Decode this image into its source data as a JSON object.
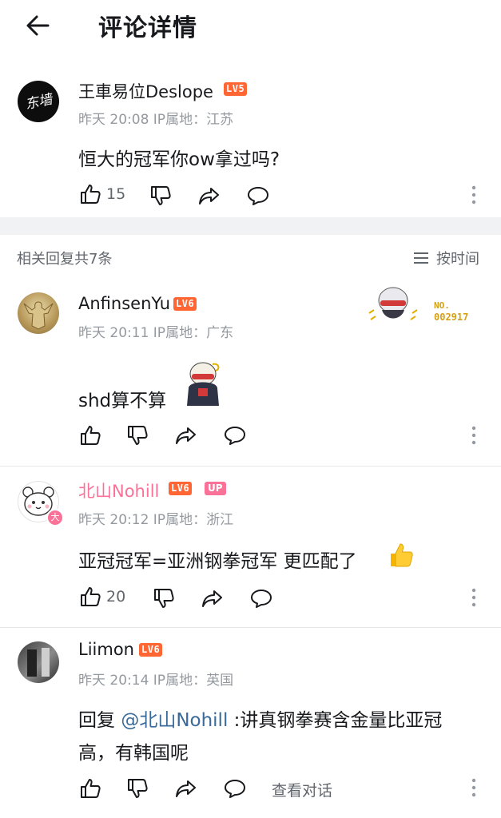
{
  "header": {
    "title": "评论详情"
  },
  "main_comment": {
    "username": "王車易位Deslope",
    "level": "LV5",
    "avatar_text": "东墙",
    "meta": "昨天 20:08 IP属地：江苏",
    "text": "恒大的冠军你ow拿过吗?",
    "likes": "15"
  },
  "replies_header": {
    "count_label": "相关回复共7条",
    "sort_label": "按时间"
  },
  "replies": [
    {
      "username": "AnfinsenYu",
      "level": "LV6",
      "meta": "昨天 20:11 IP属地：广东",
      "text": "shd算不算",
      "badge_no_label": "NO.",
      "badge_no_value": "002917"
    },
    {
      "username": "北山Nohill",
      "level": "LV6",
      "up_badge": "UP",
      "avatar_badge": "大",
      "meta": "昨天 20:12 IP属地：浙江",
      "text": "亚冠冠军=亚洲钢拳冠军 更匹配了",
      "likes": "20"
    },
    {
      "username": "Liimon",
      "level": "LV6",
      "meta": "昨天 20:14 IP属地：英国",
      "text_prefix": "回复 ",
      "mention": "@北山Nohill",
      "text_rest": " :讲真钢拳赛含金量比亚冠",
      "text_line2": "高，有韩国呢",
      "view_conversation": "查看对话"
    }
  ],
  "colors": {
    "level_orange": "#ff6633",
    "up_pink": "#fb7299",
    "mention_blue": "#3a6a9a",
    "meta_gray": "#9499a0"
  },
  "icons": [
    "back-arrow-icon",
    "thumbs-up-icon",
    "thumbs-down-icon",
    "share-icon",
    "comment-icon",
    "more-icon",
    "sort-lines-icon",
    "thumbs-up-emoji-icon"
  ]
}
